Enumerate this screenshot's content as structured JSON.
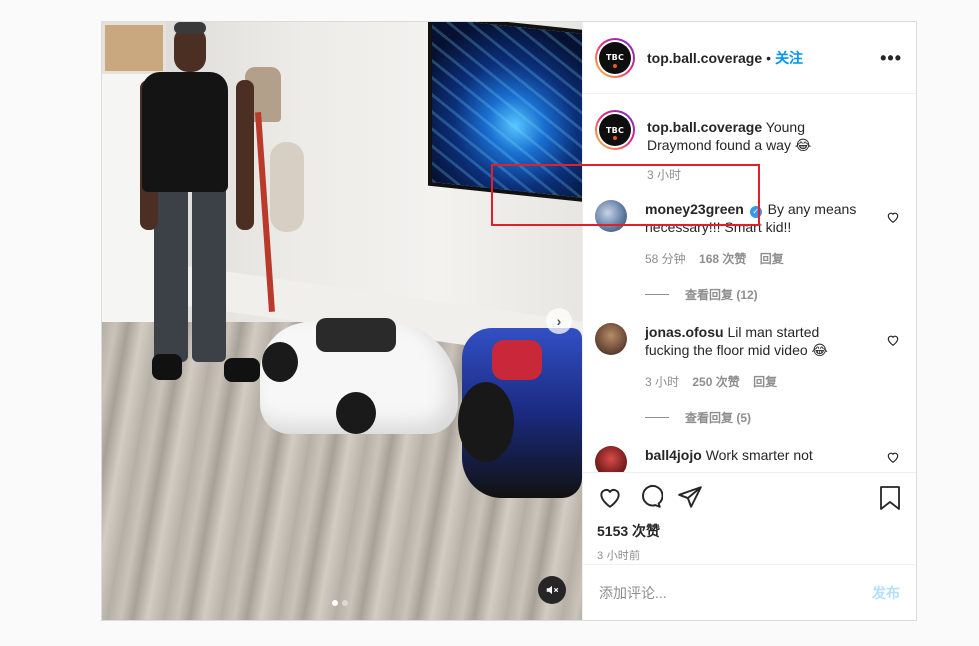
{
  "header": {
    "username": "top.ball.coverage",
    "separator": "•",
    "follow_label": "关注",
    "more_label": "•••",
    "avatar_text": "TBC"
  },
  "caption": {
    "username": "top.ball.coverage",
    "text": "Young Draymond found a way 😂",
    "time": "3 小时",
    "avatar_text": "TBC"
  },
  "comments": [
    {
      "username": "money23green",
      "verified": "✓",
      "text": "By any means necessary!!! Smart kid!!",
      "time": "58 分钟",
      "likes": "168 次赞",
      "reply_label": "回复",
      "view_replies": "查看回复 (12)"
    },
    {
      "username": "jonas.ofosu",
      "text": "Lil man started fucking the floor mid video 😂",
      "time": "3 小时",
      "likes": "250 次赞",
      "reply_label": "回复",
      "view_replies": "查看回复 (5)"
    },
    {
      "username": "ball4jojo",
      "text": "Work smarter not"
    }
  ],
  "actions": {
    "likes_count": "5153 次赞",
    "time_ago": "3 小时前"
  },
  "add_comment": {
    "placeholder": "添加评论...",
    "post_label": "发布"
  },
  "media": {
    "next_icon": "›",
    "mute_icon": "speaker-muted-icon"
  },
  "colors": {
    "accent": "#0095f6",
    "highlight": "#e0202a",
    "muted_text": "#8e8e8e"
  }
}
